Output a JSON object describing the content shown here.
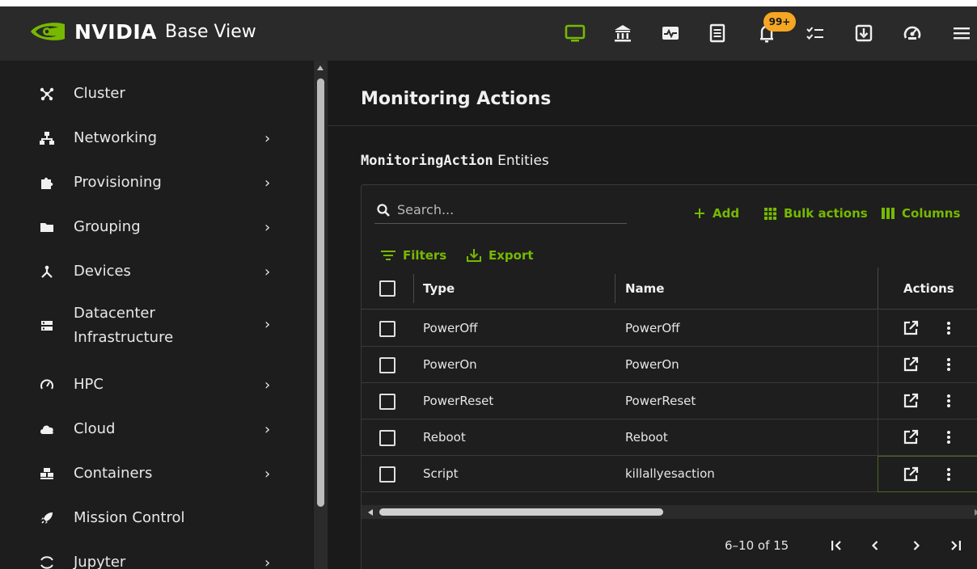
{
  "header": {
    "brand": "NVIDIA",
    "app_name": "Base View",
    "notification_badge": "99+",
    "accent_color": "#76b900",
    "icons": [
      "monitor-icon",
      "bank-icon",
      "pulse-icon",
      "document-list-icon",
      "bell-icon",
      "checklist-icon",
      "download-icon",
      "gauge-icon",
      "menu-icon"
    ]
  },
  "sidebar": {
    "items": [
      {
        "label": "Cluster",
        "icon": "cluster-icon",
        "chevron": ""
      },
      {
        "label": "Networking",
        "icon": "network-icon",
        "chevron": "›"
      },
      {
        "label": "Provisioning",
        "icon": "puzzle-icon",
        "chevron": "›"
      },
      {
        "label": "Grouping",
        "icon": "folder-icon",
        "chevron": "›"
      },
      {
        "label": "Devices",
        "icon": "devices-icon",
        "chevron": "›"
      },
      {
        "label": "Datacenter",
        "label2": "Infrastructure",
        "icon": "server-icon",
        "chevron": "›"
      },
      {
        "label": "HPC",
        "icon": "speedometer-icon",
        "chevron": "›"
      },
      {
        "label": "Cloud",
        "icon": "cloud-icon",
        "chevron": "›"
      },
      {
        "label": "Containers",
        "icon": "containers-icon",
        "chevron": "›"
      },
      {
        "label": "Mission Control",
        "icon": "rocket-icon",
        "chevron": ""
      },
      {
        "label": "Jupyter",
        "icon": "jupyter-icon",
        "chevron": "›"
      }
    ]
  },
  "main": {
    "title": "Monitoring Actions",
    "entity_name": "MonitoringAction",
    "entity_suffix": " Entities",
    "search_placeholder": "Search...",
    "add_label": "Add",
    "bulk_label": "Bulk actions",
    "columns_label": "Columns",
    "filters_label": "Filters",
    "export_label": "Export",
    "columns": {
      "type": "Type",
      "name": "Name",
      "actions": "Actions"
    },
    "rows": [
      {
        "type": "PowerOff",
        "name": "PowerOff"
      },
      {
        "type": "PowerOn",
        "name": "PowerOn"
      },
      {
        "type": "PowerReset",
        "name": "PowerReset"
      },
      {
        "type": "Reboot",
        "name": "Reboot"
      },
      {
        "type": "Script",
        "name": "killallyesaction"
      }
    ],
    "pagination": {
      "range": "6–10 of 15"
    }
  }
}
